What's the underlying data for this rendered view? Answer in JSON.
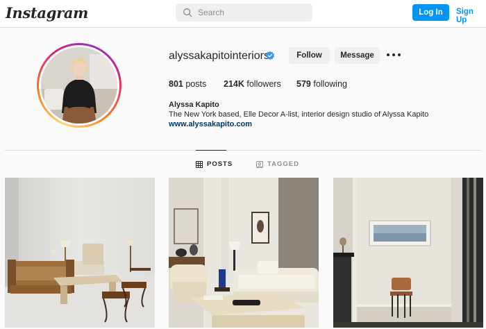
{
  "header": {
    "logo": "Instagram",
    "search_placeholder": "Search",
    "login_label": "Log In",
    "signup_label": "Sign Up"
  },
  "profile": {
    "username": "alyssakapitointeriors",
    "verified": true,
    "follow_label": "Follow",
    "message_label": "Message",
    "stats": {
      "posts_count": "801",
      "posts_label": "posts",
      "followers_count": "214K",
      "followers_label": "followers",
      "following_count": "579",
      "following_label": "following"
    },
    "full_name": "Alyssa Kapito",
    "bio": "The New York based, Elle Decor A-list, interior design studio of Alyssa Kapito",
    "website": "www.alyssakapito.com"
  },
  "tabs": [
    {
      "label": "POSTS",
      "icon": "grid-icon",
      "active": true
    },
    {
      "label": "TAGGED",
      "icon": "tag-icon",
      "active": false
    }
  ],
  "colors": {
    "accent": "#0095f6",
    "link": "#00376b",
    "verified": "#3897f0"
  }
}
